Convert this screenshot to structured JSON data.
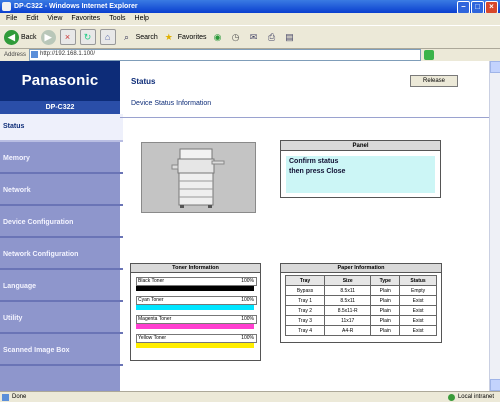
{
  "window": {
    "title": "DP-C322 - Windows Internet Explorer",
    "minimize_icon": "minimize-icon",
    "maximize_icon": "maximize-icon",
    "close_icon": "close-icon"
  },
  "menu": [
    "File",
    "Edit",
    "View",
    "Favorites",
    "Tools",
    "Help"
  ],
  "toolbar": {
    "back_label": "Back",
    "search_label": "Search",
    "favorites_label": "Favorites"
  },
  "address": {
    "label": "Address",
    "url": "http://192.168.1.100/"
  },
  "sidebar": {
    "brand": "Panasonic",
    "model": "DP-C322",
    "items": [
      {
        "label": "Status"
      },
      {
        "label": "Memory"
      },
      {
        "label": "Network"
      },
      {
        "label": "Device Configuration"
      },
      {
        "label": "Network Configuration"
      },
      {
        "label": "Language"
      },
      {
        "label": "Utility"
      },
      {
        "label": "Scanned Image Box"
      }
    ]
  },
  "header": {
    "title": "Status",
    "subtitle": "Device Status Information",
    "release_button": "Release"
  },
  "panel": {
    "title": "Panel",
    "line1": "Confirm status",
    "line2": "then press Close"
  },
  "toner": {
    "title": "Toner Information",
    "items": [
      {
        "name": "Black Toner",
        "percent": "100%",
        "fill": 1.0,
        "color": "#000000"
      },
      {
        "name": "Cyan Toner",
        "percent": "100%",
        "fill": 1.0,
        "color": "#00e5ff"
      },
      {
        "name": "Magenta Toner",
        "percent": "100%",
        "fill": 1.0,
        "color": "#ff3fd0"
      },
      {
        "name": "Yellow Toner",
        "percent": "100%",
        "fill": 1.0,
        "color": "#ffee00"
      }
    ]
  },
  "paper": {
    "title": "Paper Information",
    "headers": [
      "Tray",
      "Size",
      "Type",
      "Status"
    ],
    "rows": [
      [
        "Bypass",
        "8.5x11",
        "Plain",
        "Empty"
      ],
      [
        "Tray 1",
        "8.5x11",
        "Plain",
        "Exist"
      ],
      [
        "Tray 2",
        "8.5x11-R",
        "Plain",
        "Exist"
      ],
      [
        "Tray 3",
        "11x17",
        "Plain",
        "Exist"
      ],
      [
        "Tray 4",
        "A4-R",
        "Plain",
        "Exist"
      ]
    ]
  },
  "status_bar": {
    "left": "Done",
    "right": "Local intranet"
  },
  "colors": {
    "brand_navy": "#0d2c78",
    "nav_bg": "#8e96cc",
    "lcd": "#ccf6f6"
  }
}
